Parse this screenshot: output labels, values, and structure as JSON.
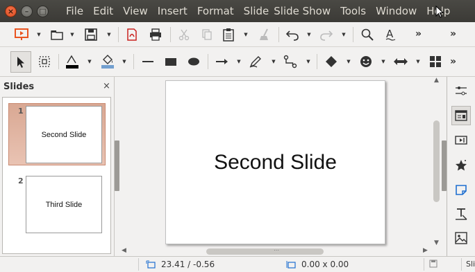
{
  "menu": {
    "items": [
      "File",
      "Edit",
      "View",
      "Insert",
      "Format",
      "Slide",
      "Slide Show",
      "Tools",
      "Window",
      "Help"
    ]
  },
  "window_buttons": {
    "close": "×",
    "minimize": "–",
    "maximize": "□"
  },
  "toolbar_standard": {
    "icons": [
      "start-presentation-icon",
      "open-icon",
      "save-icon",
      "export-pdf-icon",
      "print-icon",
      "cut-icon",
      "copy-icon",
      "paste-icon",
      "clone-formatting-icon",
      "undo-icon",
      "redo-icon",
      "find-replace-icon",
      "spelling-icon"
    ],
    "more": "»"
  },
  "toolbar_drawing": {
    "icons": [
      "select-icon",
      "zoom-pan-icon",
      "line-color-icon",
      "fill-color-icon",
      "line-icon",
      "rectangle-icon",
      "ellipse-icon",
      "arrow-line-icon",
      "curve-icon",
      "connector-icon",
      "basic-shapes-icon",
      "symbol-shapes-icon",
      "block-arrows-icon",
      "flowchart-icon"
    ],
    "line_color": "#000000",
    "fill_color": "#729fcf",
    "more": "»"
  },
  "slides_panel": {
    "title": "Slides",
    "close": "×",
    "slides": [
      {
        "number": "1",
        "title": "Second Slide",
        "selected": true
      },
      {
        "number": "2",
        "title": "Third Slide",
        "selected": false
      }
    ]
  },
  "canvas": {
    "slide_title": "Second Slide"
  },
  "sidebar": {
    "icons": [
      "properties-icon",
      "slide-layout-icon",
      "slide-transition-icon",
      "animation-icon",
      "master-slides-icon",
      "styles-icon",
      "gallery-icon"
    ]
  },
  "statusbar": {
    "position": "23.41 / -0.56",
    "size": "0.00 x 0.00",
    "slide_partial": "Sli"
  },
  "colors": {
    "accent": "#e95420",
    "selection": "#d9a893"
  }
}
